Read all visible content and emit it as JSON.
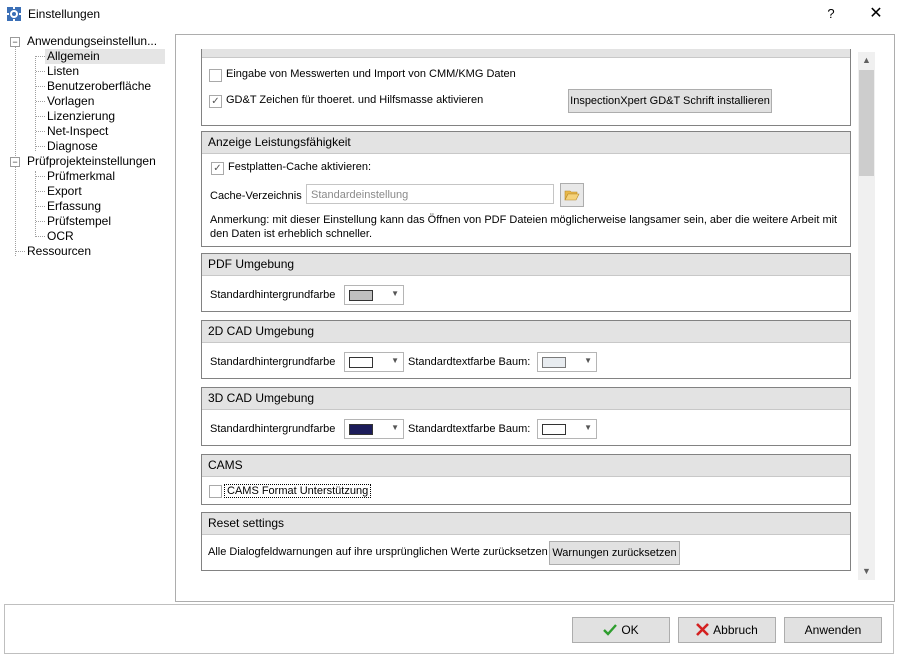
{
  "window": {
    "title": "Einstellungen",
    "help_label": "?",
    "close_label": "✕"
  },
  "tree": {
    "root1": "Anwendungseinstellun...",
    "root1_children": [
      "Allgemein",
      "Listen",
      "Benutzeroberfläche",
      "Vorlagen",
      "Lizenzierung",
      "Net-Inspect",
      "Diagnose"
    ],
    "root2": "Prüfprojekteinstellungen",
    "root2_children": [
      "Prüfmerkmal",
      "Export",
      "Erfassung",
      "Prüfstempel",
      "OCR"
    ],
    "root3": "Ressourcen",
    "selected": "Allgemein",
    "toggle_label": "−"
  },
  "sections": {
    "top": {
      "measure_import_label": "Eingabe von Messwerten und Import von CMM/KMG Daten",
      "measure_import_checked": false,
      "gdt_label": "GD&T Zeichen für thoeret. und Hilfsmasse aktivieren",
      "gdt_checked": true,
      "gdt_font_button": "InspectionXpert GD&T Schrift installieren"
    },
    "performance": {
      "title": "Anzeige Leistungsfähigkeit",
      "cache_label": "Festplatten-Cache aktivieren:",
      "cache_checked": true,
      "cache_dir_label": "Cache-Verzeichnis",
      "cache_dir_placeholder": "Standardeinstellung",
      "note": "Anmerkung: mit dieser Einstellung kann das Öffnen von PDF Dateien möglicherweise langsamer sein, aber die weitere Arbeit mit den Daten ist erheblich schneller."
    },
    "pdf": {
      "title": "PDF Umgebung",
      "bg_label": "Standardhintergrundfarbe",
      "bg_color": "#c0c0c0"
    },
    "cad2d": {
      "title": "2D CAD Umgebung",
      "bg_label": "Standardhintergrundfarbe",
      "bg_color": "#ffffff",
      "tree_text_label": "Standardtextfarbe Baum:",
      "tree_text_color": "#e8ecf0"
    },
    "cad3d": {
      "title": "3D CAD Umgebung",
      "bg_label": "Standardhintergrundfarbe",
      "bg_color": "#1c1c5a",
      "tree_text_label": "Standardtextfarbe Baum:",
      "tree_text_color": "#ffffff"
    },
    "cams": {
      "title": "CAMS",
      "format_label": "CAMS Format Unterstützung",
      "format_checked": false
    },
    "reset": {
      "title": "Reset settings",
      "description": "Alle Dialogfeldwarnungen auf ihre ursprünglichen Werte zurücksetzen",
      "button": "Warnungen zurücksetzen"
    }
  },
  "footer": {
    "ok": "OK",
    "cancel": "Abbruch",
    "apply": "Anwenden"
  },
  "icons": {
    "check": "✓",
    "dropdown": "▼",
    "scroll_up": "▲",
    "scroll_down": "▼",
    "ok_icon_color": "#2e9e2e",
    "cancel_icon_color": "#d42020"
  }
}
